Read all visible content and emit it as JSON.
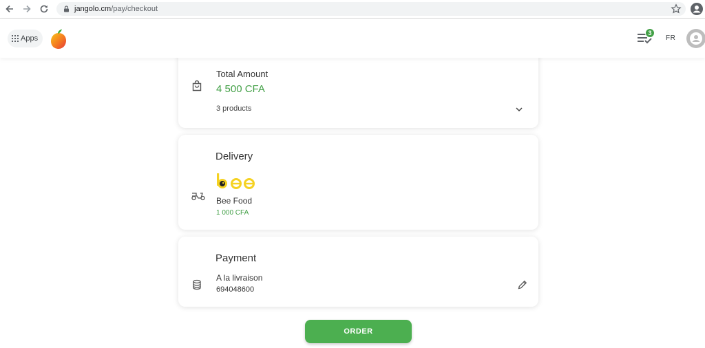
{
  "browser": {
    "url_host": "jangolo.cm",
    "url_path": "/pay/checkout"
  },
  "header": {
    "apps_label": "Apps",
    "orders_badge": "3",
    "language": "FR"
  },
  "summary": {
    "label": "Total Amount",
    "amount": "4 500 CFA",
    "products": "3 products"
  },
  "delivery": {
    "title": "Delivery",
    "provider_logo_text": "bee",
    "provider": "Bee Food",
    "price": "1 000 CFA"
  },
  "payment": {
    "title": "Payment",
    "method": "A la livraison",
    "phone": "694048600"
  },
  "actions": {
    "order_label": "ORDER"
  },
  "colors": {
    "accent": "#43a047",
    "button": "#4caf50",
    "bee_yellow": "#f5d222"
  }
}
